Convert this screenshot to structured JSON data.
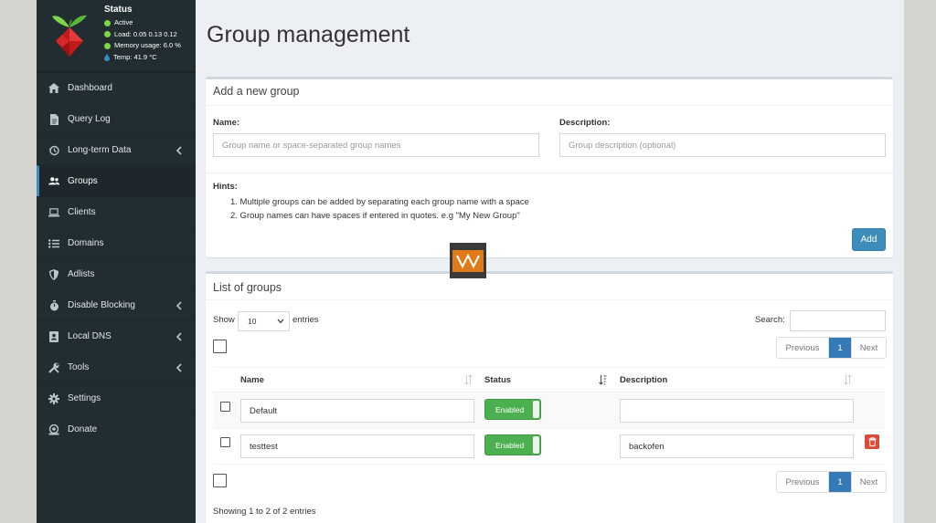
{
  "status": {
    "title": "Status",
    "active": "Active",
    "load": "Load:  0.05  0.13  0.12",
    "memory": "Memory usage:  6.0 %",
    "temp": "Temp: 41.9 °C"
  },
  "sidebar": {
    "items": [
      {
        "label": "Dashboard",
        "icon": "home-icon"
      },
      {
        "label": "Query Log",
        "icon": "file-icon"
      },
      {
        "label": "Long-term Data",
        "icon": "history-icon"
      },
      {
        "label": "Groups",
        "icon": "users-icon"
      },
      {
        "label": "Clients",
        "icon": "laptop-icon"
      },
      {
        "label": "Domains",
        "icon": "list-icon"
      },
      {
        "label": "Adlists",
        "icon": "shield-icon"
      },
      {
        "label": "Disable Blocking",
        "icon": "stopwatch-icon"
      },
      {
        "label": "Local DNS",
        "icon": "address-book-icon"
      },
      {
        "label": "Tools",
        "icon": "tools-icon"
      },
      {
        "label": "Settings",
        "icon": "gear-icon"
      },
      {
        "label": "Donate",
        "icon": "donate-icon"
      }
    ]
  },
  "page": {
    "title": "Group management"
  },
  "add_group": {
    "header": "Add a new group",
    "name_label": "Name:",
    "name_placeholder": "Group name or space-separated group names",
    "desc_label": "Description:",
    "desc_placeholder": "Group description (optional)",
    "hints_title": "Hints:",
    "hint1": "1. Multiple groups can be added by separating each group name with a space",
    "hint2": "2. Group names can have spaces if entered in quotes. e.g \"My New Group\"",
    "add_label": "Add"
  },
  "list": {
    "header": "List of groups",
    "show_label": "Show",
    "show_value": "10",
    "entries_label": "entries",
    "search_label": "Search:",
    "prev": "Previous",
    "page": "1",
    "next": "Next",
    "col_name": "Name",
    "col_status": "Status",
    "col_desc": "Description",
    "rows": [
      {
        "name": "Default",
        "status": "Enabled",
        "description": ""
      },
      {
        "name": "testtest",
        "status": "Enabled",
        "description": "backofen"
      }
    ],
    "summary": "Showing 1 to 2 of 2 entries"
  },
  "colors": {
    "sidebar_bg": "#222d32",
    "primary": "#3c8dbc",
    "enabled": "#4caf50",
    "danger": "#dd4b39"
  }
}
